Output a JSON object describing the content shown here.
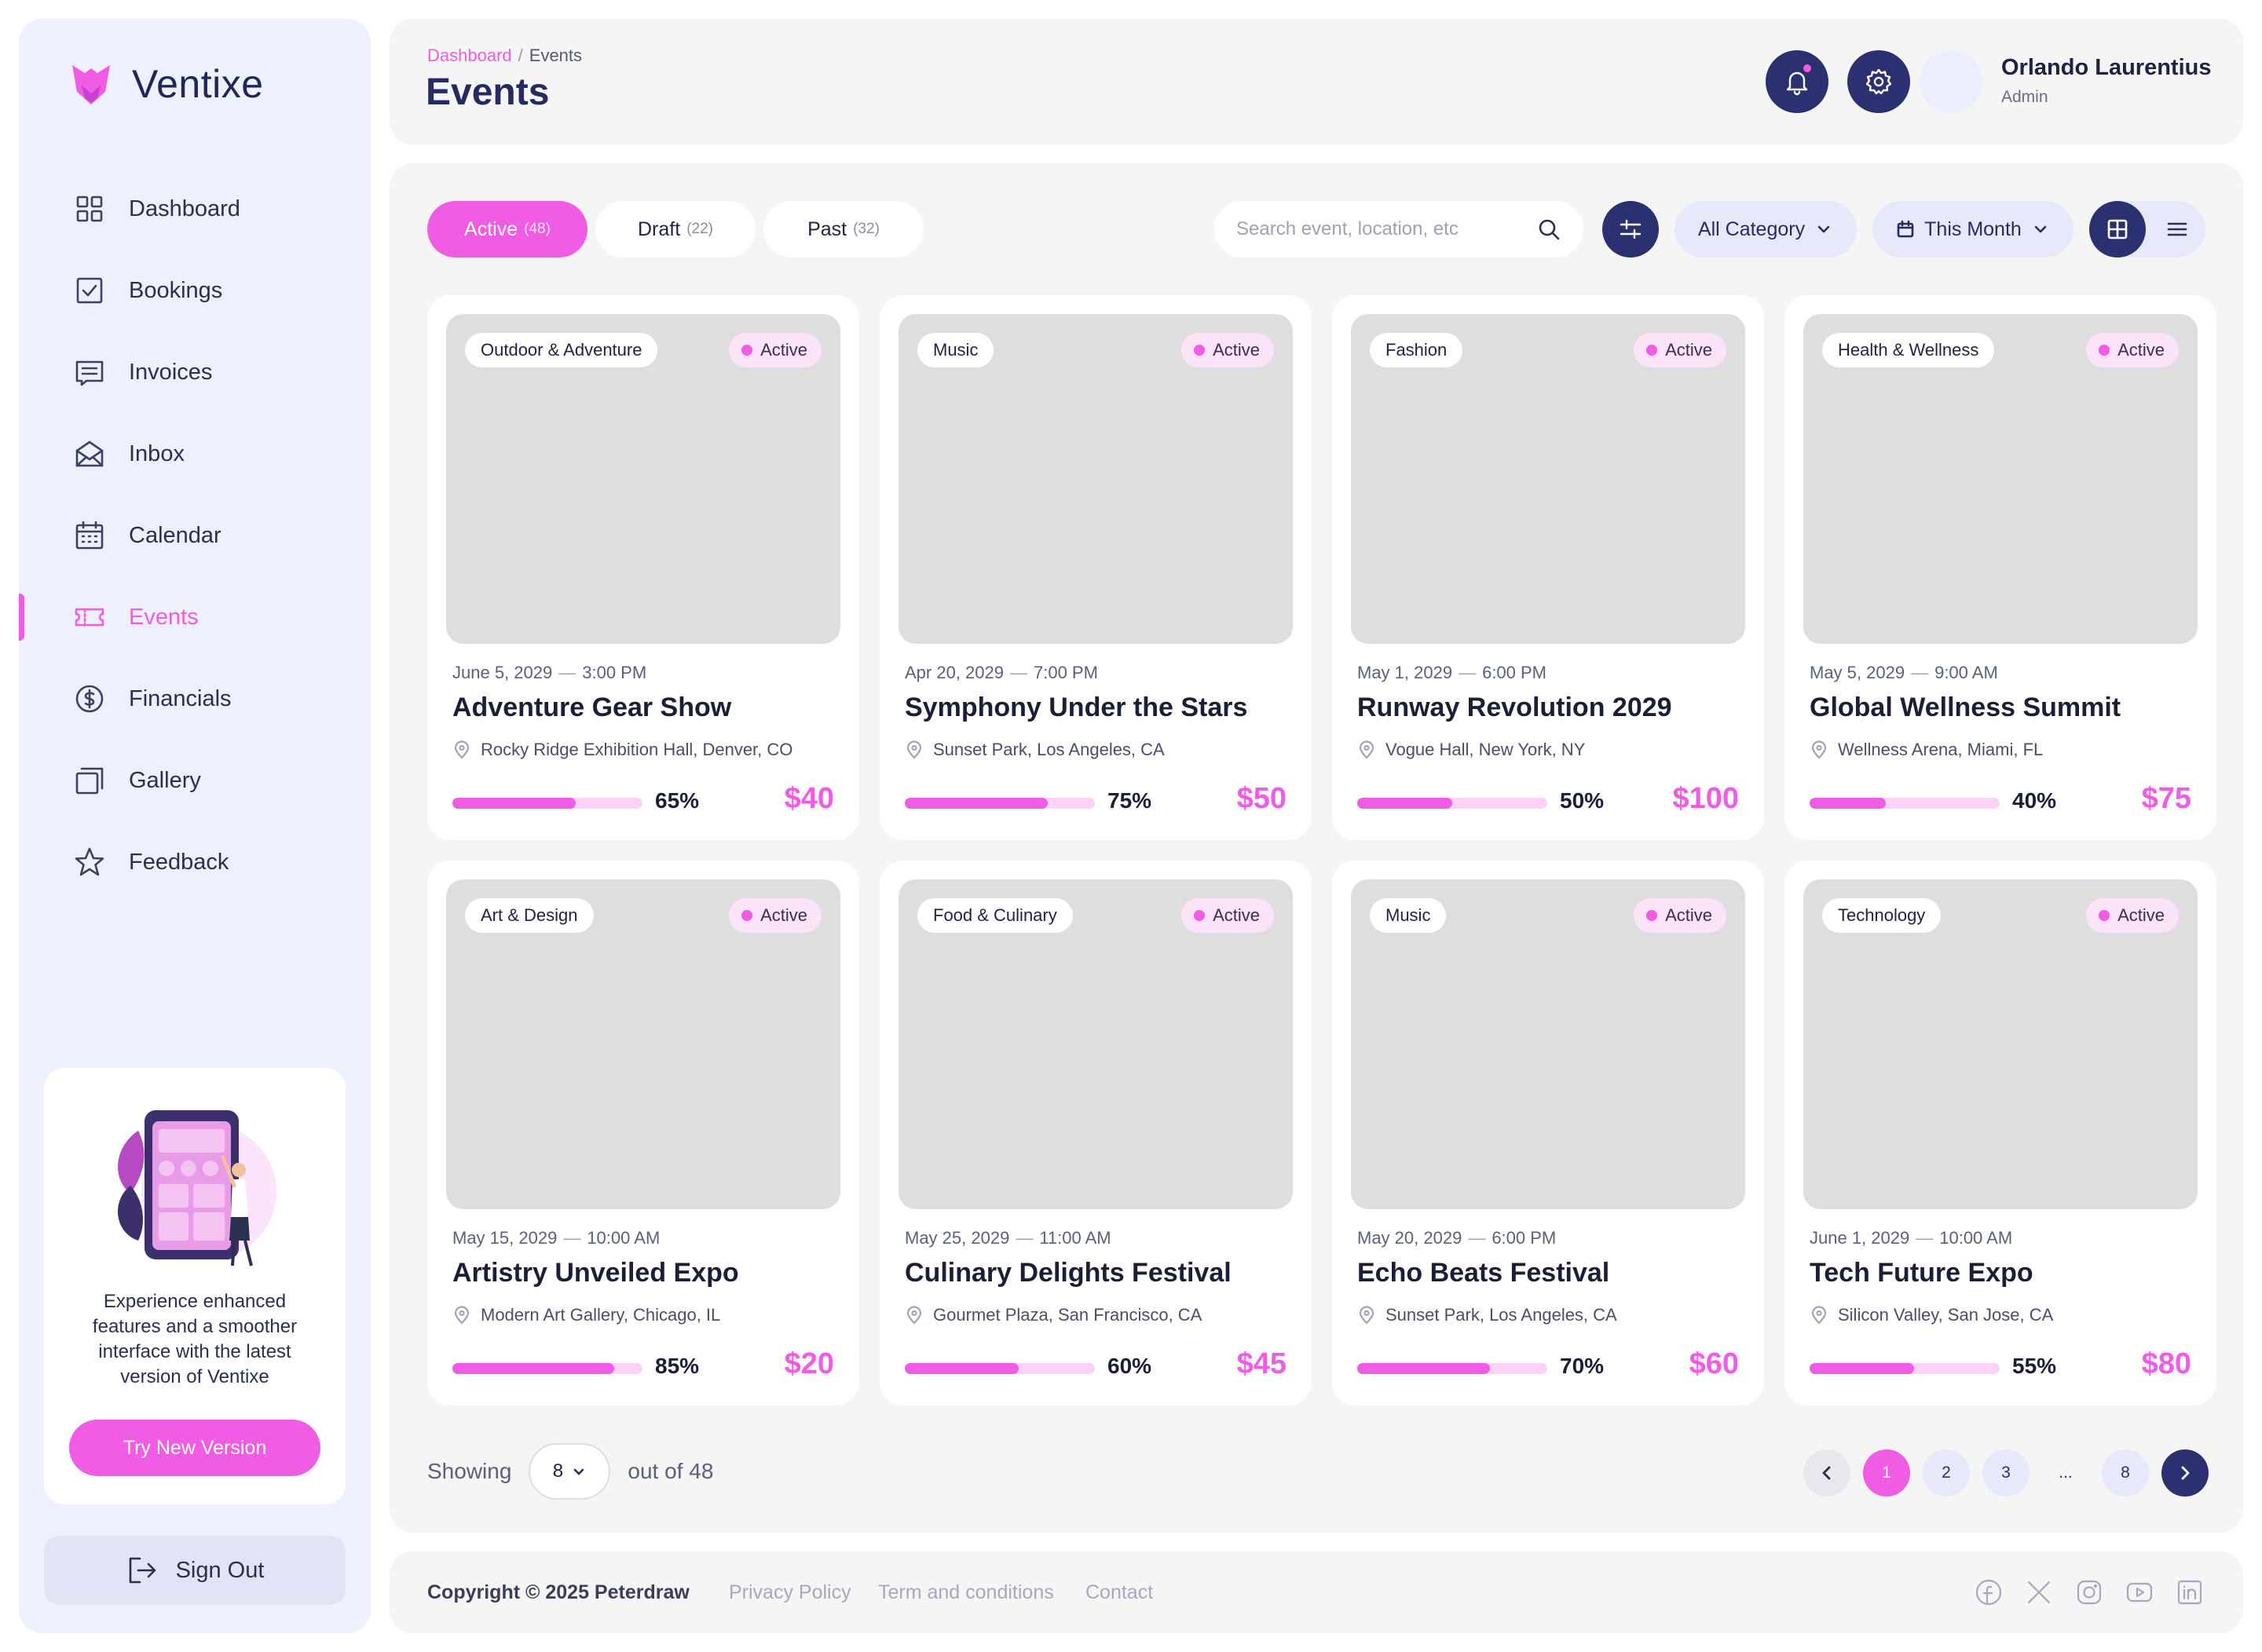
{
  "brand": {
    "name": "Ventixe",
    "accent": "#f05ce4",
    "navy": "#2b3070"
  },
  "sidebar": {
    "items": [
      {
        "label": "Dashboard",
        "icon": "dashboard-icon"
      },
      {
        "label": "Bookings",
        "icon": "bookings-icon"
      },
      {
        "label": "Invoices",
        "icon": "invoices-icon"
      },
      {
        "label": "Inbox",
        "icon": "inbox-icon"
      },
      {
        "label": "Calendar",
        "icon": "calendar-icon"
      },
      {
        "label": "Events",
        "icon": "ticket-icon",
        "active": true
      },
      {
        "label": "Financials",
        "icon": "dollar-icon"
      },
      {
        "label": "Gallery",
        "icon": "gallery-icon"
      },
      {
        "label": "Feedback",
        "icon": "star-icon"
      }
    ],
    "promo": {
      "text": "Experience enhanced features and a smoother interface with the latest version of Ventixe",
      "button": "Try New Version"
    },
    "signout": "Sign Out"
  },
  "header": {
    "breadcrumb": {
      "home": "Dashboard",
      "separator": "/",
      "current": "Events"
    },
    "title": "Events",
    "user": {
      "name": "Orlando Laurentius",
      "role": "Admin"
    }
  },
  "toolbar": {
    "tabs": [
      {
        "label": "Active",
        "count": "(48)",
        "active": true
      },
      {
        "label": "Draft",
        "count": "(22)"
      },
      {
        "label": "Past",
        "count": "(32)"
      }
    ],
    "search_placeholder": "Search event, location, etc",
    "category": "All Category",
    "period": "This Month"
  },
  "events": [
    {
      "category": "Outdoor & Adventure",
      "status": "Active",
      "date": "June 5, 2029",
      "time": "3:00 PM",
      "title": "Adventure Gear Show",
      "location": "Rocky Ridge Exhibition Hall, Denver, CO",
      "progress": 65,
      "progress_label": "65%",
      "price": "$40"
    },
    {
      "category": "Music",
      "status": "Active",
      "date": "Apr 20, 2029",
      "time": "7:00 PM",
      "title": "Symphony Under the Stars",
      "location": "Sunset Park, Los Angeles, CA",
      "progress": 75,
      "progress_label": "75%",
      "price": "$50"
    },
    {
      "category": "Fashion",
      "status": "Active",
      "date": "May 1, 2029",
      "time": "6:00 PM",
      "title": "Runway Revolution 2029",
      "location": "Vogue Hall, New York, NY",
      "progress": 50,
      "progress_label": "50%",
      "price": "$100"
    },
    {
      "category": "Health & Wellness",
      "status": "Active",
      "date": "May 5, 2029",
      "time": "9:00 AM",
      "title": "Global Wellness Summit",
      "location": "Wellness Arena, Miami, FL",
      "progress": 40,
      "progress_label": "40%",
      "price": "$75"
    },
    {
      "category": "Art & Design",
      "status": "Active",
      "date": "May 15, 2029",
      "time": "10:00 AM",
      "title": "Artistry Unveiled Expo",
      "location": "Modern Art Gallery, Chicago, IL",
      "progress": 85,
      "progress_label": "85%",
      "price": "$20"
    },
    {
      "category": "Food & Culinary",
      "status": "Active",
      "date": "May 25, 2029",
      "time": "11:00 AM",
      "title": "Culinary Delights Festival",
      "location": "Gourmet Plaza, San Francisco, CA",
      "progress": 60,
      "progress_label": "60%",
      "price": "$45"
    },
    {
      "category": "Music",
      "status": "Active",
      "date": "May 20, 2029",
      "time": "6:00 PM",
      "title": "Echo Beats Festival",
      "location": "Sunset Park, Los Angeles, CA",
      "progress": 70,
      "progress_label": "70%",
      "price": "$60"
    },
    {
      "category": "Technology",
      "status": "Active",
      "date": "June 1, 2029",
      "time": "10:00 AM",
      "title": "Tech Future Expo",
      "location": "Silicon Valley, San Jose, CA",
      "progress": 55,
      "progress_label": "55%",
      "price": "$80"
    }
  ],
  "pagination": {
    "showing_label": "Showing",
    "page_size": "8",
    "total_label": "out of 48",
    "pages": [
      "1",
      "2",
      "3",
      "...",
      "8"
    ],
    "current": "1"
  },
  "footer": {
    "copyright": "Copyright © 2025 Peterdraw",
    "links": [
      "Privacy Policy",
      "Term and conditions",
      "Contact"
    ],
    "social": [
      "facebook-icon",
      "x-icon",
      "instagram-icon",
      "youtube-icon",
      "linkedin-icon"
    ]
  }
}
